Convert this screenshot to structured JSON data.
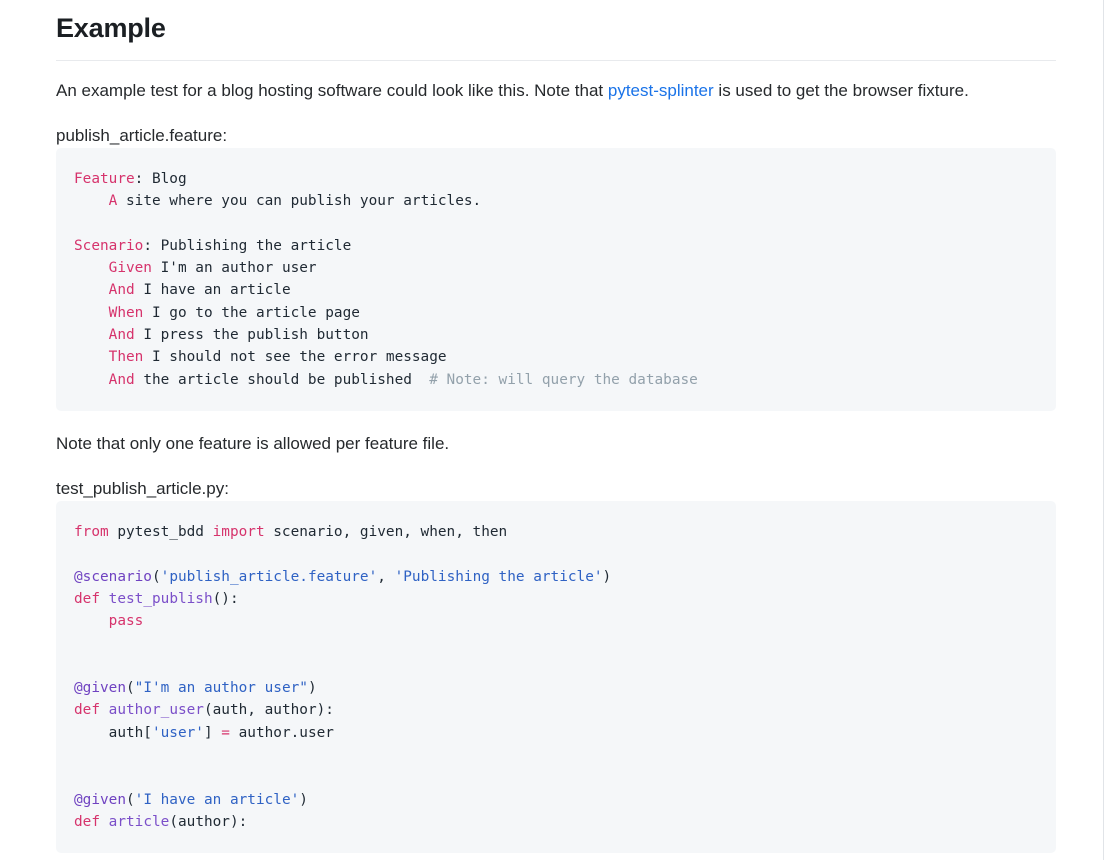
{
  "page": {
    "title": "Example",
    "intro": {
      "before_link": "An example test for a blog hosting software could look like this. Note that ",
      "link_text": "pytest-splinter",
      "after_link": " is used to get the browser fixture."
    },
    "feature_file_caption": "publish_article.feature:",
    "note_text": "Note that only one feature is allowed per feature file.",
    "python_file_caption": "test_publish_article.py:"
  },
  "colors": {
    "link": "#1a73e8",
    "keyword": "#d6336c",
    "string": "#2f62c4",
    "decorator": "#6f42c1",
    "function": "#7b4fc9",
    "comment": "#93a1ab",
    "code_background": "#f5f7f9",
    "text": "#26292c"
  },
  "feature_code": {
    "language": "gherkin",
    "lines": [
      [
        {
          "t": "Feature",
          "c": "kw"
        },
        {
          "t": ": Blog",
          "c": "def"
        }
      ],
      [
        {
          "t": "    ",
          "c": "def"
        },
        {
          "t": "A",
          "c": "kw"
        },
        {
          "t": " site where you can publish your articles.",
          "c": "def"
        }
      ],
      [],
      [
        {
          "t": "Scenario",
          "c": "kw"
        },
        {
          "t": ": Publishing the article",
          "c": "def"
        }
      ],
      [
        {
          "t": "    ",
          "c": "def"
        },
        {
          "t": "Given",
          "c": "kw"
        },
        {
          "t": " I'm an author user",
          "c": "def"
        }
      ],
      [
        {
          "t": "    ",
          "c": "def"
        },
        {
          "t": "And",
          "c": "kw"
        },
        {
          "t": " I have an article",
          "c": "def"
        }
      ],
      [
        {
          "t": "    ",
          "c": "def"
        },
        {
          "t": "When",
          "c": "kw"
        },
        {
          "t": " I go to the article page",
          "c": "def"
        }
      ],
      [
        {
          "t": "    ",
          "c": "def"
        },
        {
          "t": "And",
          "c": "kw"
        },
        {
          "t": " I press the publish button",
          "c": "def"
        }
      ],
      [
        {
          "t": "    ",
          "c": "def"
        },
        {
          "t": "Then",
          "c": "kw"
        },
        {
          "t": " I should not see the error message",
          "c": "def"
        }
      ],
      [
        {
          "t": "    ",
          "c": "def"
        },
        {
          "t": "And",
          "c": "kw"
        },
        {
          "t": " the article should be published  ",
          "c": "def"
        },
        {
          "t": "# Note: will query the database",
          "c": "com"
        }
      ]
    ]
  },
  "python_code": {
    "language": "python",
    "lines": [
      [
        {
          "t": "from",
          "c": "kw"
        },
        {
          "t": " pytest_bdd ",
          "c": "def"
        },
        {
          "t": "import",
          "c": "kw"
        },
        {
          "t": " scenario, given, when, then",
          "c": "def"
        }
      ],
      [],
      [
        {
          "t": "@scenario",
          "c": "dec"
        },
        {
          "t": "(",
          "c": "def"
        },
        {
          "t": "'publish_article.feature'",
          "c": "str"
        },
        {
          "t": ", ",
          "c": "def"
        },
        {
          "t": "'Publishing the article'",
          "c": "str"
        },
        {
          "t": ")",
          "c": "def"
        }
      ],
      [
        {
          "t": "def",
          "c": "kw"
        },
        {
          "t": " ",
          "c": "def"
        },
        {
          "t": "test_publish",
          "c": "fn"
        },
        {
          "t": "():",
          "c": "def"
        }
      ],
      [
        {
          "t": "    ",
          "c": "def"
        },
        {
          "t": "pass",
          "c": "kw"
        }
      ],
      [],
      [],
      [
        {
          "t": "@given",
          "c": "dec"
        },
        {
          "t": "(",
          "c": "def"
        },
        {
          "t": "\"I'm an author user\"",
          "c": "str"
        },
        {
          "t": ")",
          "c": "def"
        }
      ],
      [
        {
          "t": "def",
          "c": "kw"
        },
        {
          "t": " ",
          "c": "def"
        },
        {
          "t": "author_user",
          "c": "fn"
        },
        {
          "t": "(auth, author):",
          "c": "def"
        }
      ],
      [
        {
          "t": "    auth[",
          "c": "def"
        },
        {
          "t": "'user'",
          "c": "str"
        },
        {
          "t": "] ",
          "c": "def"
        },
        {
          "t": "=",
          "c": "kw"
        },
        {
          "t": " author.user",
          "c": "def"
        }
      ],
      [],
      [],
      [
        {
          "t": "@given",
          "c": "dec"
        },
        {
          "t": "(",
          "c": "def"
        },
        {
          "t": "'I have an article'",
          "c": "str"
        },
        {
          "t": ")",
          "c": "def"
        }
      ],
      [
        {
          "t": "def",
          "c": "kw"
        },
        {
          "t": " ",
          "c": "def"
        },
        {
          "t": "article",
          "c": "fn"
        },
        {
          "t": "(author):",
          "c": "def"
        }
      ]
    ]
  }
}
